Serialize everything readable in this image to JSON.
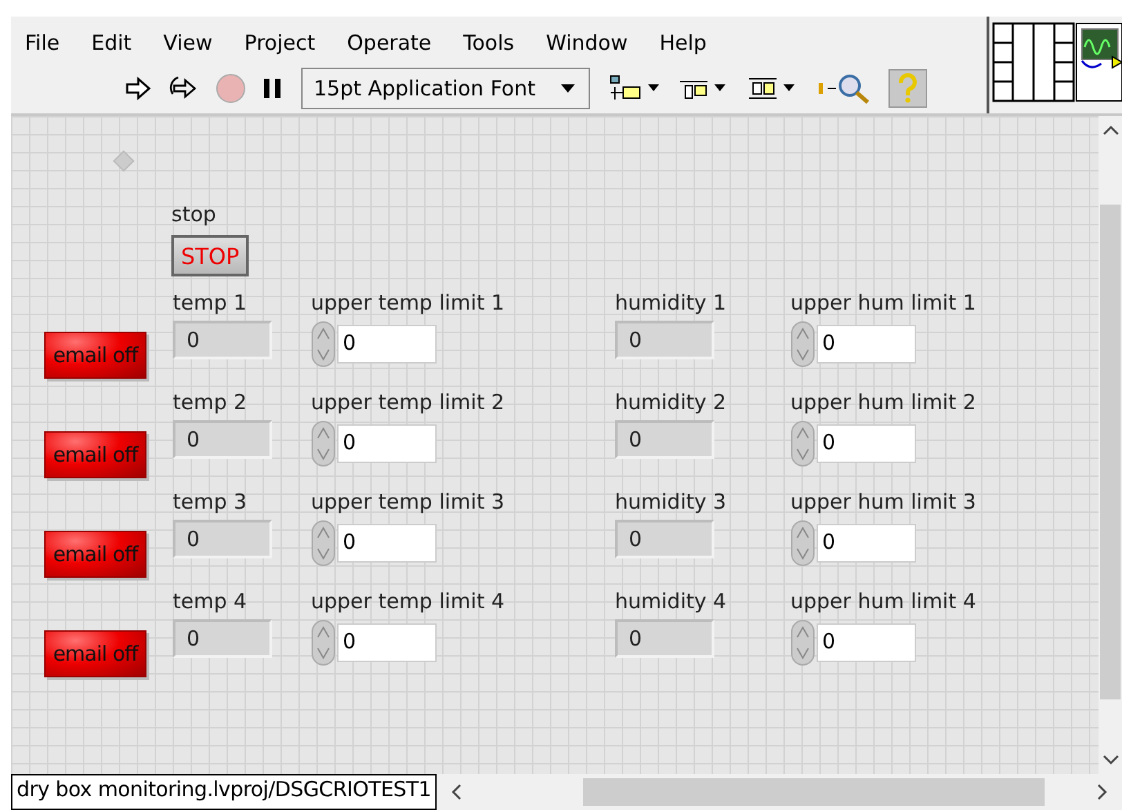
{
  "menu": [
    "File",
    "Edit",
    "View",
    "Project",
    "Operate",
    "Tools",
    "Window",
    "Help"
  ],
  "toolbar": {
    "font": "15pt Application Font",
    "help_on": true
  },
  "stop": {
    "label": "stop",
    "button": "STOP"
  },
  "rows": [
    {
      "email": "email off",
      "temp_label": "temp 1",
      "temp": "0",
      "temp_limit_label": "upper temp limit 1",
      "temp_limit": "0",
      "hum_label": "humidity 1",
      "hum": "0",
      "hum_limit_label": "upper hum limit 1",
      "hum_limit": "0"
    },
    {
      "email": "email off",
      "temp_label": "temp 2",
      "temp": "0",
      "temp_limit_label": "upper temp limit 2",
      "temp_limit": "0",
      "hum_label": "humidity 2",
      "hum": "0",
      "hum_limit_label": "upper hum limit 2",
      "hum_limit": "0"
    },
    {
      "email": "email off",
      "temp_label": "temp 3",
      "temp": "0",
      "temp_limit_label": "upper temp limit 3",
      "temp_limit": "0",
      "hum_label": "humidity 3",
      "hum": "0",
      "hum_limit_label": "upper hum limit 3",
      "hum_limit": "0"
    },
    {
      "email": "email off",
      "temp_label": "temp 4",
      "temp": "0",
      "temp_limit_label": "upper temp limit 4",
      "temp_limit": "0",
      "hum_label": "humidity 4",
      "hum": "0",
      "hum_limit_label": "upper hum limit 4",
      "hum_limit": "0"
    }
  ],
  "status_bar": "dry box monitoring.lvproj/DSGCRIOTEST1"
}
